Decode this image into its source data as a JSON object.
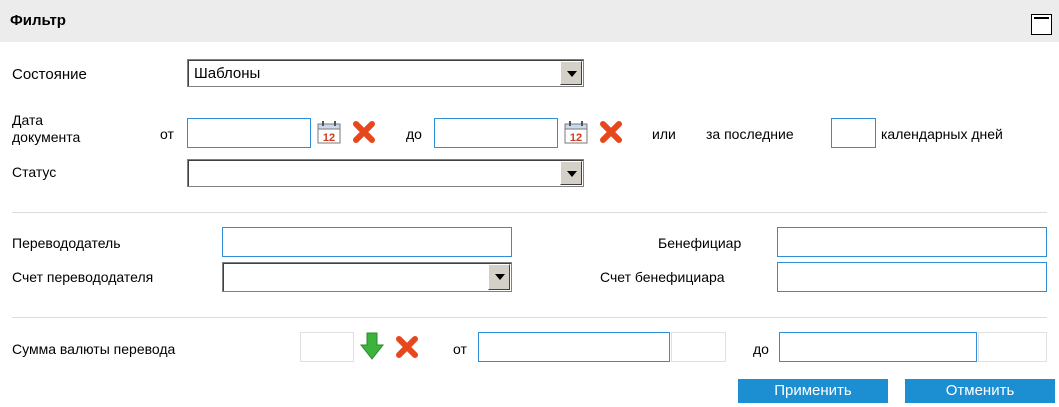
{
  "filter": {
    "title": "Фильтр",
    "state": {
      "label": "Состояние",
      "value": "Шаблоны"
    },
    "doc_date": {
      "label_line1": "Дата",
      "label_line2": "документа",
      "from_label": "от",
      "to_label": "до",
      "or_label": "или",
      "last_label": "за последние",
      "days_label": "календарных дней",
      "from_value": "",
      "to_value": "",
      "days_value": ""
    },
    "status": {
      "label": "Статус",
      "value": ""
    },
    "sender": {
      "label": "Перевододатель",
      "value": ""
    },
    "sender_account": {
      "label": "Счет перевододателя",
      "value": ""
    },
    "beneficiary": {
      "label": "Бенефициар",
      "value": ""
    },
    "beneficiary_account": {
      "label": "Счет бенефициара",
      "value": ""
    },
    "amount": {
      "label": "Сумма валюты перевода",
      "from_label": "от",
      "to_label": "до",
      "currency_value": "",
      "from_value": "",
      "to_value": ""
    },
    "buttons": {
      "apply": "Применить",
      "cancel": "Отменить"
    },
    "colors": {
      "accent": "#1b8fd2",
      "input_border": "#2f8fd6",
      "header_bg": "#ececec",
      "clear_red": "#e8461c",
      "arrow_green": "#3cb43c"
    }
  }
}
